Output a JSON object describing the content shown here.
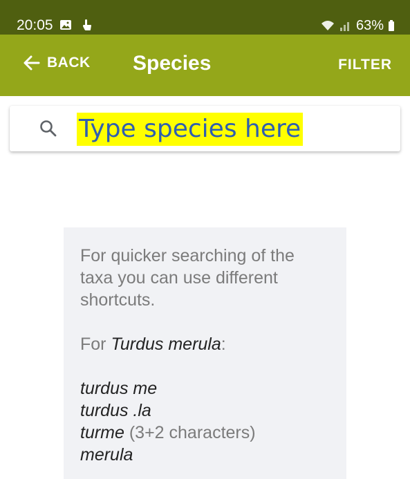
{
  "status_bar": {
    "time": "20:05",
    "battery": "63%",
    "icons": [
      "image-icon",
      "touch-icon",
      "wifi-icon",
      "signal-icon",
      "battery-icon"
    ],
    "background_color": "#4f5f10"
  },
  "app_bar": {
    "back_label": "BACK",
    "title": "Species",
    "filter_label": "FILTER",
    "background_color": "#94a71a"
  },
  "search": {
    "placeholder": "Type species here",
    "highlight_color": "#ffff00"
  },
  "hint": {
    "intro": "For quicker searching of the taxa you can use different shortcuts.",
    "for_prefix": "For ",
    "for_species": "Turdus merula",
    "for_suffix": ":",
    "examples": [
      {
        "code": "turdus me",
        "note": ""
      },
      {
        "code": "turdus .la",
        "note": ""
      },
      {
        "code": "turme",
        "note": " (3+2 characters)"
      },
      {
        "code": "merula",
        "note": ""
      }
    ]
  }
}
